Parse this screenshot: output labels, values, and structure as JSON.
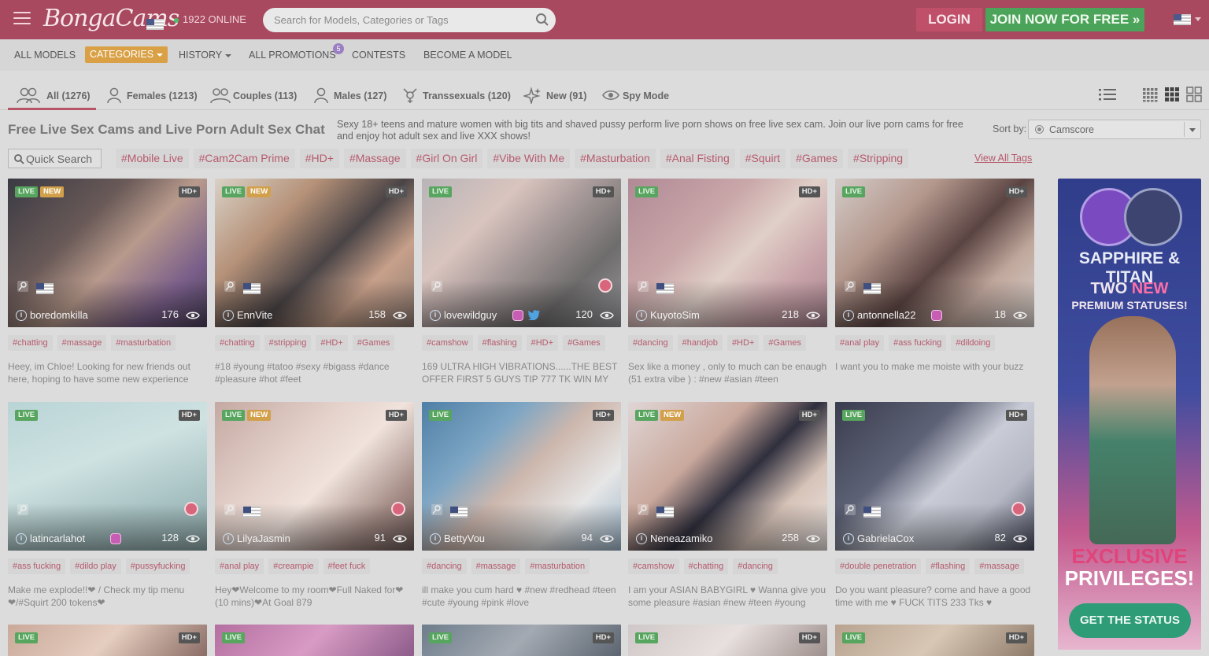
{
  "header": {
    "logo_text": "BongaCams",
    "online_text": "1922 ONLINE",
    "search_placeholder": "Search for Models, Categories or Tags",
    "login_label": "LOGIN",
    "join_label": "JOIN NOW FOR FREE »"
  },
  "nav": {
    "all_models": "ALL MODELS",
    "categories": "CATEGORIES",
    "history": "HISTORY",
    "all_promotions": "ALL PROMOTIONS",
    "promotions_badge": "5",
    "contests": "CONTESTS",
    "become_model": "BECOME A MODEL"
  },
  "tabs": [
    {
      "label": "All (1276)",
      "icon": "group-icon"
    },
    {
      "label": "Females (1213)",
      "icon": "female-icon"
    },
    {
      "label": "Couples (113)",
      "icon": "couple-icon"
    },
    {
      "label": "Males (127)",
      "icon": "male-icon"
    },
    {
      "label": "Transsexuals (120)",
      "icon": "trans-icon"
    },
    {
      "label": "New (91)",
      "icon": "sparkle-icon"
    },
    {
      "label": "Spy Mode",
      "icon": "eye-icon"
    }
  ],
  "intro": {
    "title": "Free Live Sex Cams and Live Porn Adult Sex Chat",
    "text": "Sexy 18+ teens and mature women with big tits and shaved pussy perform live porn shows on free live sex cam. Join our live porn cams for free and enjoy hot adult sex and live XXX shows!",
    "sort_label": "Sort by:",
    "sort_value": "Camscore"
  },
  "tagbar": {
    "quick_search_placeholder": "Quick Search",
    "tags": [
      "#Mobile Live",
      "#Cam2Cam Prime",
      "#HD+",
      "#Massage",
      "#Girl On Girl",
      "#Vibe With Me",
      "#Masturbation",
      "#Anal Fisting",
      "#Squirt",
      "#Games",
      "#Stripping"
    ],
    "view_all": "View All Tags"
  },
  "badges": {
    "live": "LIVE",
    "new": "NEW",
    "hd": "HD+"
  },
  "models": [
    {
      "name": "boredomkilla",
      "viewers": "176",
      "new": true,
      "hd": true,
      "flag": true,
      "round": false,
      "ig": false,
      "tw": false,
      "tags": [
        "#chatting",
        "#massage",
        "#masturbation"
      ],
      "desc": "Heey, im Chloe! Looking for new friends out here, hoping to have some new experience",
      "bg": "linear-gradient(135deg,#3b3a44 0%,#6a5a58 35%,#b89a8c 55%,#7a5f8a 80%,#4a3f5a 100%)"
    },
    {
      "name": "EnnVite",
      "viewers": "158",
      "new": true,
      "hd": true,
      "flag": true,
      "round": false,
      "ig": false,
      "tw": false,
      "tags": [
        "#chatting",
        "#stripping",
        "#HD+",
        "#Games"
      ],
      "desc": "#18 #young #tatoo #sexy #bigass #dance #pleasure #hot #feet",
      "bg": "linear-gradient(135deg,#d9d1c6 0%,#b59178 30%,#4a4446 55%,#c7a08a 75%,#8d7a72 100%)"
    },
    {
      "name": "lovewildguy",
      "viewers": "120",
      "new": false,
      "hd": true,
      "flag": false,
      "round": true,
      "ig": true,
      "tw": true,
      "tags": [
        "#camshow",
        "#flashing",
        "#HD+",
        "#Games"
      ],
      "desc": "169 ULTRA HIGH VIBRATIONS......THE BEST OFFER FIRST 5 GUYS TIP 777 TK WIN MY",
      "bg": "linear-gradient(135deg,#b8b4b8 0%,#d9c4be 30%,#a89a9a 50%,#6e6c6c 75%,#9a9a9e 100%)"
    },
    {
      "name": "KuyotoSim",
      "viewers": "218",
      "new": false,
      "hd": true,
      "flag": true,
      "round": false,
      "ig": false,
      "tw": false,
      "tags": [
        "#dancing",
        "#handjob",
        "#HD+",
        "#Games"
      ],
      "desc": "Sex like a money , only to much can be enaugh (51 extra vibe ) : #new #asian #teen",
      "bg": "linear-gradient(135deg,#b08a96 0%,#c9a6a8 35%,#e0cfc8 55%,#caa7ab 75%,#a88290 100%)"
    },
    {
      "name": "antonnella22",
      "viewers": "18",
      "new": false,
      "hd": true,
      "flag": true,
      "round": false,
      "ig": true,
      "tw": false,
      "tags": [
        "#anal play",
        "#ass fucking",
        "#dildoing"
      ],
      "desc": "I want you to make me moiste with your buzz",
      "bg": "linear-gradient(135deg,#d3cbc8 0%,#b3978c 30%,#5a4442 55%,#c0a79c 75%,#d8d0cc 100%)"
    },
    {
      "name": "latincarlahot",
      "viewers": "128",
      "new": false,
      "hd": true,
      "flag": false,
      "round": true,
      "ig": true,
      "tw": false,
      "tags": [
        "#ass fucking",
        "#dildo play",
        "#pussyfucking"
      ],
      "desc": "Make me explode!!❤ / Check my tip menu ❤/#Squirt 200 tokens❤",
      "bg": "linear-gradient(160deg,#b9d4d6 0%,#cfe2e2 40%,#a9c3c4 70%,#8fa9ab 100%)"
    },
    {
      "name": "LilyaJasmin",
      "viewers": "91",
      "new": true,
      "hd": true,
      "flag": true,
      "round": true,
      "ig": false,
      "tw": false,
      "tags": [
        "#anal play",
        "#creampie",
        "#feet fuck"
      ],
      "desc": "Hey❤Welcome to my room❤Full Naked for❤ (10 mins)❤At Goal 879",
      "bg": "linear-gradient(135deg,#c4a9a2 0%,#e3d0c9 35%,#f0e2dc 55%,#a58c86 80%,#6a5a58 100%)"
    },
    {
      "name": "BettyVou",
      "viewers": "94",
      "new": false,
      "hd": true,
      "flag": true,
      "round": false,
      "ig": false,
      "tw": false,
      "tags": [
        "#dancing",
        "#massage",
        "#masturbation"
      ],
      "desc": "ill make you cum hard ♥ #new #redhead #teen #cute #young #pink #love",
      "bg": "linear-gradient(135deg,#4f7fa6 0%,#7ea6c4 30%,#cdb7ad 50%,#e6e6e6 75%,#9fb8cc 100%)"
    },
    {
      "name": "Neneazamiko",
      "viewers": "258",
      "new": true,
      "hd": true,
      "flag": true,
      "round": false,
      "ig": false,
      "tw": false,
      "tags": [
        "#camshow",
        "#chatting",
        "#dancing"
      ],
      "desc": "I am your ASIAN BABYGIRL ♥ Wanna give you some pleasure #asian #new #teen #young",
      "bg": "linear-gradient(135deg,#e0d6d6 0%,#c9a89c 35%,#2f2f3d 55%,#d7c3b8 75%,#ece5e2 100%)"
    },
    {
      "name": "GabrielaCox",
      "viewers": "82",
      "new": false,
      "hd": true,
      "flag": true,
      "round": true,
      "ig": false,
      "tw": false,
      "tags": [
        "#double penetration",
        "#flashing",
        "#massage"
      ],
      "desc": "Do you want pleasure? come and have a good time with me ♥ FUCK TITS 233 Tks ♥",
      "bg": "linear-gradient(135deg,#3a3d4e 0%,#5e6276 35%,#c9ccd6 55%,#b5b8c4 75%,#4a4d60 100%)"
    }
  ],
  "row3": [
    {
      "new": false,
      "hd": true,
      "bg": "linear-gradient(135deg,#c9a99a,#e5cdbf,#8a6c64)"
    },
    {
      "new": false,
      "hd": false,
      "bg": "linear-gradient(135deg,#b46fa0,#d89bc4,#8d5c8a)"
    },
    {
      "new": false,
      "hd": true,
      "bg": "linear-gradient(135deg,#6e7d8c,#a4aab2,#5b6470)"
    },
    {
      "new": false,
      "hd": true,
      "bg": "linear-gradient(135deg,#cfc8c8,#e8e0de,#9d8f8c)"
    },
    {
      "new": false,
      "hd": true,
      "bg": "linear-gradient(135deg,#b8a38f,#d8c7b5,#8e7a68)"
    }
  ],
  "ad": {
    "line1": "SAPPHIRE & TITAN",
    "line2a": "TWO ",
    "line2b": "NEW",
    "line3": "PREMIUM STATUSES!",
    "line4a": "EXCLUSIVE",
    "line4b": "PRIVILEGES!",
    "button": "GET THE STATUS"
  }
}
